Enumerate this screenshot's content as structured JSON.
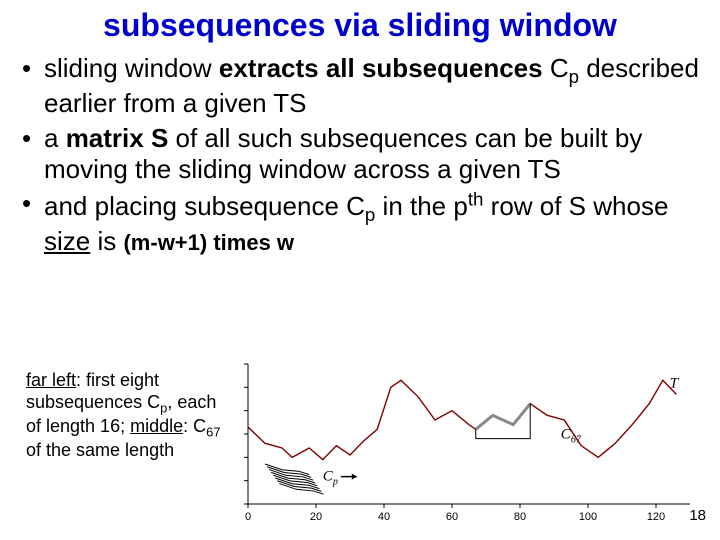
{
  "title": "subsequences via sliding window",
  "bullets": [
    {
      "pre": "sliding window ",
      "bold": "extracts all subsequences",
      "post1": " C",
      "sub": "p",
      "post2": " described earlier from a given TS"
    },
    {
      "pre": "a ",
      "bold": "matrix S",
      "post": " of all such subsequences can be built by moving the sliding window across a given TS"
    },
    {
      "pre": "and placing subsequence C",
      "sub1": "p",
      "mid": " in the p",
      "sup": "th",
      "post1": " row of S whose ",
      "underline": "size",
      "post2": " is ",
      "boldsize": "(m-w+1) times w"
    }
  ],
  "caption": {
    "l1a": "far left",
    "l1b": ": first eight subsequences C",
    "l1sub": "p",
    "l1c": ", each of length 16; ",
    "l2a": "middle",
    "l2b": ": C",
    "l2sub": "67",
    "l2c": " of the same length"
  },
  "chart_data": {
    "type": "line",
    "title": "",
    "xlabel": "",
    "ylabel": "",
    "xlim": [
      0,
      130
    ],
    "ylim": [
      -3,
      3
    ],
    "xticks": [
      0,
      20,
      40,
      60,
      80,
      100,
      120
    ],
    "annotations": [
      {
        "text": "T",
        "x": 124,
        "y": 2.0
      },
      {
        "text": "C",
        "sub": "67",
        "x": 92,
        "y": -0.2
      },
      {
        "text": "C",
        "sub": "p",
        "x": 22,
        "y": -2.0
      }
    ],
    "series": [
      {
        "name": "T",
        "color": "#800000",
        "x": [
          0,
          5,
          10,
          13,
          18,
          22,
          26,
          30,
          34,
          38,
          42,
          45,
          50,
          55,
          60,
          65,
          67,
          72,
          78,
          83,
          88,
          93,
          98,
          103,
          108,
          113,
          118,
          122,
          126
        ],
        "values": [
          0.3,
          -0.4,
          -0.6,
          -1.0,
          -0.6,
          -1.1,
          -0.5,
          -0.9,
          -0.3,
          0.2,
          2.0,
          2.3,
          1.6,
          0.6,
          1.0,
          0.4,
          0.2,
          0.8,
          0.4,
          1.3,
          0.8,
          0.6,
          -0.5,
          -1.0,
          -0.4,
          0.4,
          1.3,
          2.3,
          1.7
        ]
      },
      {
        "name": "C67",
        "color": "#888888",
        "x": [
          67,
          72,
          78,
          83
        ],
        "values": [
          0.2,
          0.8,
          0.4,
          1.3
        ]
      }
    ],
    "stacked_subsequences": {
      "count": 8,
      "length": 16,
      "x_center": 13,
      "y_base": -1.6,
      "y_step": -0.12
    }
  },
  "page_number": "18"
}
